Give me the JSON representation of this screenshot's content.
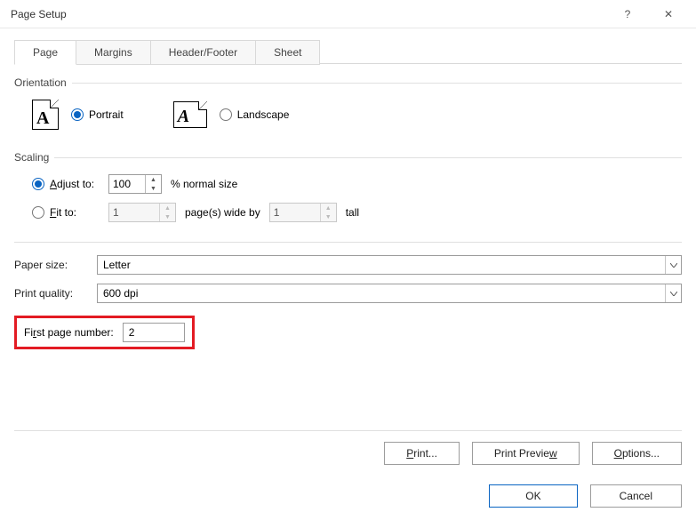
{
  "titlebar": {
    "title": "Page Setup",
    "help": "?",
    "close": "✕"
  },
  "tabs": {
    "page": "Page",
    "margins": "Margins",
    "headerfooter": "Header/Footer",
    "sheet": "Sheet"
  },
  "orientation": {
    "group": "Orientation",
    "portrait": "Portrait",
    "landscape": "Landscape",
    "selected": "portrait"
  },
  "scaling": {
    "group": "Scaling",
    "adjust_label": "Adjust to:",
    "adjust_value": "100",
    "adjust_suffix": "% normal size",
    "fit_label": "Fit to:",
    "fit_wide": "1",
    "fit_mid": "page(s) wide by",
    "fit_tall": "1",
    "fit_suffix": "tall",
    "selected": "adjust"
  },
  "paper": {
    "size_label": "Paper size:",
    "size_value": "Letter",
    "quality_label": "Print quality:",
    "quality_value": "600 dpi"
  },
  "firstpage": {
    "label": "First page number:",
    "value": "2"
  },
  "buttons": {
    "print": "Print...",
    "preview": "Print Preview",
    "options": "Options...",
    "ok": "OK",
    "cancel": "Cancel"
  }
}
